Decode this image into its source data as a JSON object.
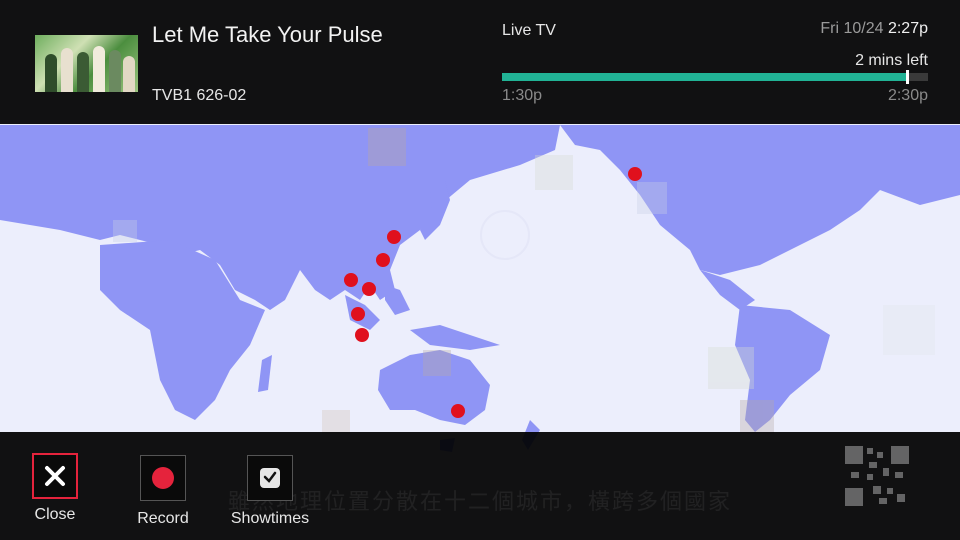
{
  "program": {
    "title": "Let Me Take Your Pulse",
    "channel": "TVB1 626-02"
  },
  "status": {
    "mode": "Live TV",
    "day_date": "Fri 10/24",
    "clock": "2:27p",
    "time_left": "2 mins left",
    "start_time": "1:30p",
    "end_time": "2:30p",
    "progress": 0.95
  },
  "video": {
    "subtitle": "雖然地理位置分散在十二個城市，橫跨多個國家"
  },
  "actions": {
    "close": {
      "label": "Close",
      "icon": "close-icon"
    },
    "record": {
      "label": "Record",
      "icon": "record-icon"
    },
    "showtimes": {
      "label": "Showtimes",
      "icon": "clock-icon"
    }
  },
  "colors": {
    "accent": "#21b395",
    "focus": "#e5233c",
    "record": "#e5233c",
    "map_land": "#8f95f5",
    "map_dot": "#e0101d"
  }
}
